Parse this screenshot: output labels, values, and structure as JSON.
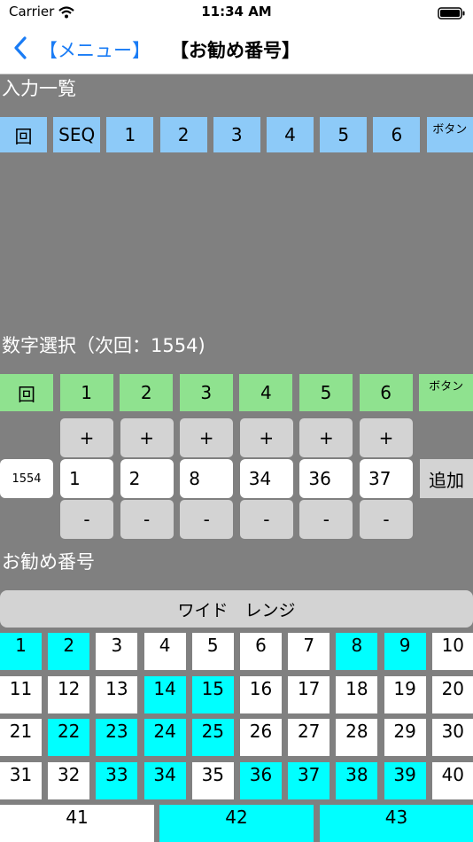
{
  "status": {
    "carrier": "Carrier",
    "time": "11:34 AM"
  },
  "nav": {
    "back_label": "【メニュー】",
    "title": "【お勧め番号】"
  },
  "input_list": {
    "label": "入力一覧",
    "headers": [
      "回",
      "SEQ",
      "1",
      "2",
      "3",
      "4",
      "5",
      "6",
      "ボタン"
    ]
  },
  "selection": {
    "label": "数字選択（次回：1554)",
    "headers": [
      "回",
      "1",
      "2",
      "3",
      "4",
      "5",
      "6",
      "ボタン"
    ],
    "plus": "+",
    "minus": "-",
    "seq_value": "1554",
    "values": [
      "1",
      "2",
      "8",
      "34",
      "36",
      "37"
    ],
    "add_label": "追加"
  },
  "recommend": {
    "label": "お勧め番号",
    "wide_range_label": "ワイド　レンジ",
    "numbers": [
      "1",
      "2",
      "3",
      "4",
      "5",
      "6",
      "7",
      "8",
      "9",
      "10",
      "11",
      "12",
      "13",
      "14",
      "15",
      "16",
      "17",
      "18",
      "19",
      "20",
      "21",
      "22",
      "23",
      "24",
      "25",
      "26",
      "27",
      "28",
      "29",
      "30",
      "31",
      "32",
      "33",
      "34",
      "35",
      "36",
      "37",
      "38",
      "39",
      "40",
      "41",
      "42",
      "43"
    ],
    "highlighted": [
      1,
      2,
      8,
      9,
      14,
      15,
      22,
      23,
      24,
      25,
      33,
      34,
      36,
      37,
      38,
      39,
      42,
      43
    ],
    "highlight_color": "#00ffff"
  },
  "colors": {
    "background": "#808080",
    "accent": "#1a7cf5",
    "header_blue": "#8dcaf8",
    "header_green": "#8fe28f"
  }
}
